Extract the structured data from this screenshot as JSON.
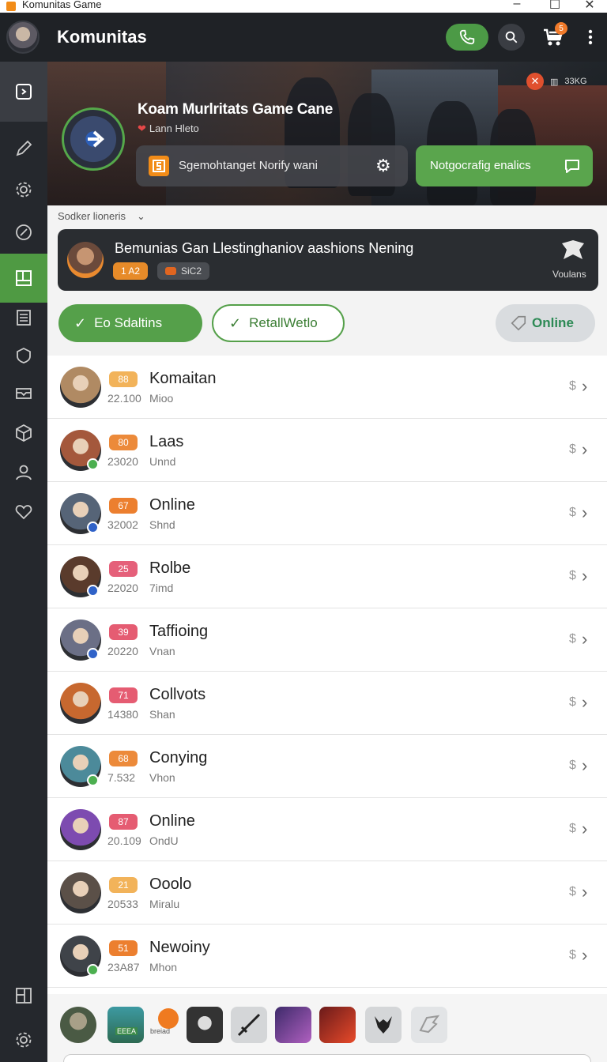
{
  "window": {
    "title": "Komunitas Game"
  },
  "header": {
    "title": "Komunitas",
    "cart_count": "5"
  },
  "hero": {
    "title": "Koam Murlritats Game Cane",
    "subtitle": "Lann Hleto",
    "notify_text": "Sgemohtanget Norify wani",
    "cta_text": "Notgocrafig enalics",
    "corner_text": "33KG"
  },
  "section": {
    "label": "Sodker lioneris"
  },
  "featured": {
    "name": "Bemunias Gan Llestinghaniov aashions Nening",
    "pill1": "1 A2",
    "pill2": "SiC2",
    "badge_label": "Voulans"
  },
  "filters": {
    "btn1": "Eo Sdaltins",
    "btn2": "RetallWetlo",
    "btn3": "Online"
  },
  "members": [
    {
      "level": "88",
      "name": "Komaitan",
      "num": "22.100",
      "sub": "Mioo",
      "lvlcolor": "#f2b35a",
      "status": "",
      "av": "#b08a63"
    },
    {
      "level": "80",
      "name": "Laas",
      "num": "23020",
      "sub": "Unnd",
      "lvlcolor": "#ec8a3a",
      "status": "#4caf50",
      "av": "#a4583c"
    },
    {
      "level": "67",
      "name": "Online",
      "num": "32002",
      "sub": "Shnd",
      "lvlcolor": "#ec7f2f",
      "status": "#2f62c8",
      "av": "#566477"
    },
    {
      "level": "25",
      "name": "Rolbe",
      "num": "22020",
      "sub": "7imd",
      "lvlcolor": "#e5607a",
      "status": "#2f62c8",
      "av": "#5a3b2c"
    },
    {
      "level": "39",
      "name": "Taffioing",
      "num": "20220",
      "sub": "Vnan",
      "lvlcolor": "#e55c72",
      "status": "#2f62c8",
      "av": "#6b6f86"
    },
    {
      "level": "71",
      "name": "Collvots",
      "num": "14380",
      "sub": "Shan",
      "lvlcolor": "#e55c72",
      "status": "",
      "av": "#c7682f"
    },
    {
      "level": "68",
      "name": "Conying",
      "num": "7.532",
      "sub": "Vhon",
      "lvlcolor": "#ec8a3a",
      "status": "#4caf50",
      "av": "#4c8a9a"
    },
    {
      "level": "87",
      "name": "Online",
      "num": "20.109",
      "sub": "OndU",
      "lvlcolor": "#e55c72",
      "status": "",
      "av": "#7d4bb0"
    },
    {
      "level": "21",
      "name": "Ooolo",
      "num": "20533",
      "sub": "Miralu",
      "lvlcolor": "#f2b35a",
      "status": "",
      "av": "#5b5048"
    },
    {
      "level": "51",
      "name": "Newoiny",
      "num": "23A87",
      "sub": "Mhon",
      "lvlcolor": "#ec7f2f",
      "status": "#4caf50",
      "av": "#3f4349"
    }
  ],
  "bottom": {
    "label1": "EEEA",
    "label2": "breiad"
  },
  "colors": {
    "accent": "#55a04a",
    "dark": "#25282d",
    "header": "#1f2226"
  }
}
